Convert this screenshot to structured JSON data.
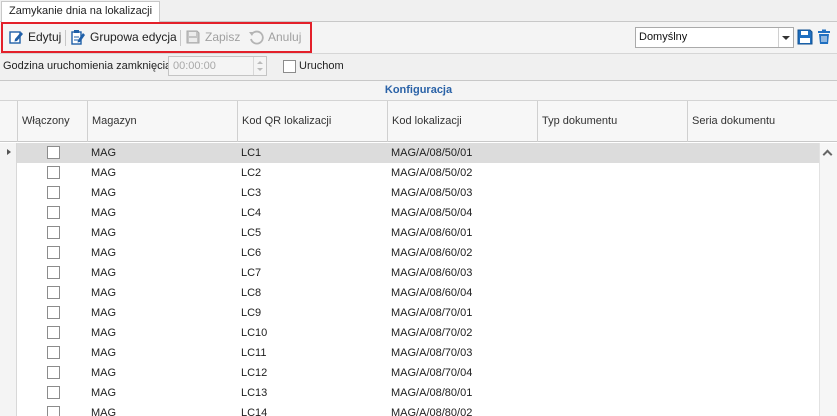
{
  "tab": {
    "title": "Zamykanie dnia na lokalizacji"
  },
  "toolbar": {
    "edit_label": "Edytuj",
    "group_edit_label": "Grupowa edycja",
    "save_label": "Zapisz",
    "cancel_label": "Anuluj",
    "layout_combo_value": "Domyślny",
    "highlight_color": "#e3202a"
  },
  "schedule": {
    "time_label": "Godzina uruchomienia zamknięcia",
    "time_value": "00:00:00",
    "run_label": "Uruchom",
    "run_checked": false
  },
  "grid": {
    "band_title": "Konfiguracja",
    "columns": [
      "Włączony",
      "Magazyn",
      "Kod QR lokalizacji",
      "Kod lokalizacji",
      "Typ dokumentu",
      "Seria dokumentu"
    ],
    "rows": [
      {
        "enabled": false,
        "warehouse": "MAG",
        "qr_code": "LC1",
        "location_code": "MAG/A/08/50/01",
        "doc_type": "",
        "doc_series": "",
        "selected": true
      },
      {
        "enabled": false,
        "warehouse": "MAG",
        "qr_code": "LC2",
        "location_code": "MAG/A/08/50/02",
        "doc_type": "",
        "doc_series": ""
      },
      {
        "enabled": false,
        "warehouse": "MAG",
        "qr_code": "LC3",
        "location_code": "MAG/A/08/50/03",
        "doc_type": "",
        "doc_series": ""
      },
      {
        "enabled": false,
        "warehouse": "MAG",
        "qr_code": "LC4",
        "location_code": "MAG/A/08/50/04",
        "doc_type": "",
        "doc_series": ""
      },
      {
        "enabled": false,
        "warehouse": "MAG",
        "qr_code": "LC5",
        "location_code": "MAG/A/08/60/01",
        "doc_type": "",
        "doc_series": ""
      },
      {
        "enabled": false,
        "warehouse": "MAG",
        "qr_code": "LC6",
        "location_code": "MAG/A/08/60/02",
        "doc_type": "",
        "doc_series": ""
      },
      {
        "enabled": false,
        "warehouse": "MAG",
        "qr_code": "LC7",
        "location_code": "MAG/A/08/60/03",
        "doc_type": "",
        "doc_series": ""
      },
      {
        "enabled": false,
        "warehouse": "MAG",
        "qr_code": "LC8",
        "location_code": "MAG/A/08/60/04",
        "doc_type": "",
        "doc_series": ""
      },
      {
        "enabled": false,
        "warehouse": "MAG",
        "qr_code": "LC9",
        "location_code": "MAG/A/08/70/01",
        "doc_type": "",
        "doc_series": ""
      },
      {
        "enabled": false,
        "warehouse": "MAG",
        "qr_code": "LC10",
        "location_code": "MAG/A/08/70/02",
        "doc_type": "",
        "doc_series": ""
      },
      {
        "enabled": false,
        "warehouse": "MAG",
        "qr_code": "LC11",
        "location_code": "MAG/A/08/70/03",
        "doc_type": "",
        "doc_series": ""
      },
      {
        "enabled": false,
        "warehouse": "MAG",
        "qr_code": "LC12",
        "location_code": "MAG/A/08/70/04",
        "doc_type": "",
        "doc_series": ""
      },
      {
        "enabled": false,
        "warehouse": "MAG",
        "qr_code": "LC13",
        "location_code": "MAG/A/08/80/01",
        "doc_type": "",
        "doc_series": ""
      },
      {
        "enabled": false,
        "warehouse": "MAG",
        "qr_code": "LC14",
        "location_code": "MAG/A/08/80/02",
        "doc_type": "",
        "doc_series": ""
      }
    ]
  },
  "icons": {
    "edit": "edit-icon",
    "group_edit": "group-edit-icon",
    "save": "save-icon",
    "cancel": "undo-icon",
    "layout_save": "save-layout-icon",
    "layout_delete": "trash-icon"
  }
}
